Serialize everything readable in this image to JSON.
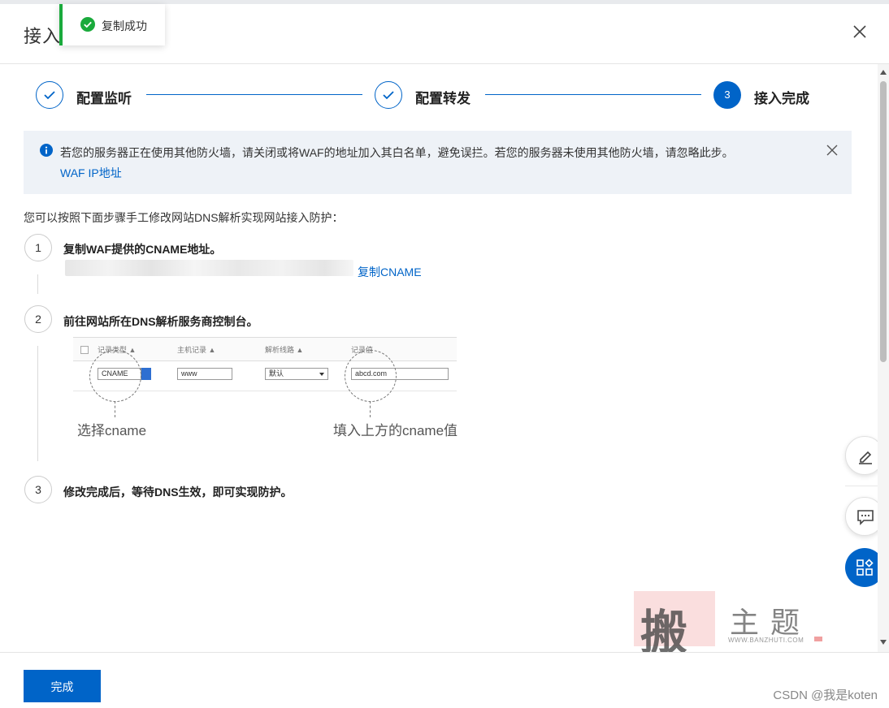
{
  "header": {
    "title": "接入"
  },
  "toast": {
    "text": "复制成功"
  },
  "steps": [
    {
      "label": "配置监听",
      "state": "done"
    },
    {
      "label": "配置转发",
      "state": "done"
    },
    {
      "label": "接入完成",
      "state": "active",
      "number": "3"
    }
  ],
  "notice": {
    "text": "若您的服务器正在使用其他防火墙，请关闭或将WAF的地址加入其白名单，避免误拦。若您的服务器未使用其他防火墙，请忽略此步。",
    "link": "WAF IP地址"
  },
  "intro": "您可以按照下面步骤手工修改网站DNS解析实现网站接入防护：",
  "instructions": [
    {
      "number": "1",
      "text": "复制WAF提供的CNAME地址。",
      "copy_link": "复制CNAME"
    },
    {
      "number": "2",
      "text": "前往网站所在DNS解析服务商控制台。"
    },
    {
      "number": "3",
      "text": "修改完成后，等待DNS生效，即可实现防护。"
    }
  ],
  "dns_example": {
    "headers": [
      "记录类型 ▲",
      "主机记录 ▲",
      "解析线路 ▲",
      "记录值"
    ],
    "type_value": "CNAME",
    "host_value": "www",
    "line_value": "默认",
    "record_value": "abcd.com",
    "note_left": "选择cname",
    "note_right": "填入上方的cname值"
  },
  "footer": {
    "done_label": "完成",
    "credit": "CSDN @我是koten"
  },
  "watermark": {
    "seal": "搬",
    "text": "主题",
    "url": "WWW.BANZHUTI.COM"
  },
  "colors": {
    "primary": "#0064c8",
    "success": "#1aaa3c",
    "notice_bg": "#eef2f7"
  }
}
